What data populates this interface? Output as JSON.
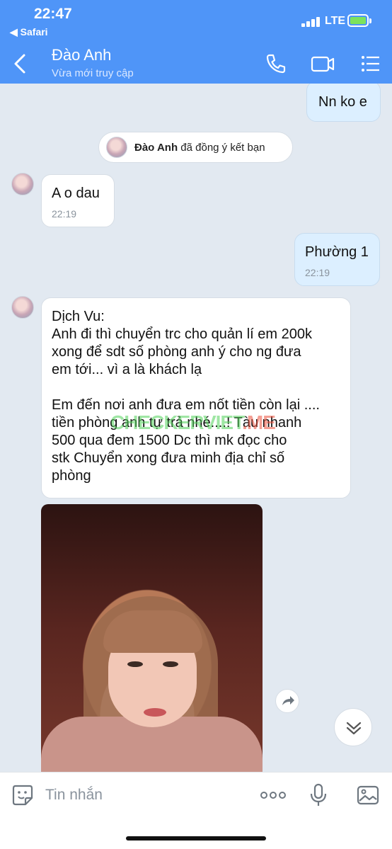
{
  "status_bar": {
    "time": "22:47",
    "back_app": "◀ Safari",
    "network": "LTE"
  },
  "header": {
    "contact_name": "Đào Anh",
    "contact_status": "Vừa mới truy cập"
  },
  "messages": {
    "m1": {
      "text": "Nn ko e"
    },
    "system": {
      "name": "Đào Anh",
      "text": " đã đồng ý kết bạn"
    },
    "m2": {
      "text": "A o dau",
      "time": "22:19"
    },
    "m3": {
      "text": "Phường 1",
      "time": "22:19"
    },
    "m4": {
      "lines": [
        "Dịch Vu:",
        "Anh đi thì chuyển trc cho quản lí em 200k",
        "xong để sdt số phòng anh ý cho ng đưa",
        "em tới... vì a là khách lạ",
        "",
        "Em đến nơi anh đưa em nốt tiền còn lại ....",
        "tiền phòng anh tự trả nhé....!  Tàu nhanh",
        "500 qua đem 1500   Dc thì mk đọc cho",
        "stk      Chuyển xong đưa minh địa chỉ số",
        "phòng"
      ]
    }
  },
  "watermark": {
    "part1": "CHECKERVIET",
    "part2": ".ME"
  },
  "input": {
    "placeholder": "Tin nhắn"
  },
  "colors": {
    "header_bg": "#4f95f8",
    "chat_bg": "#e2e9f1",
    "outgoing_bubble": "#dcefff",
    "incoming_bubble": "#ffffff"
  }
}
